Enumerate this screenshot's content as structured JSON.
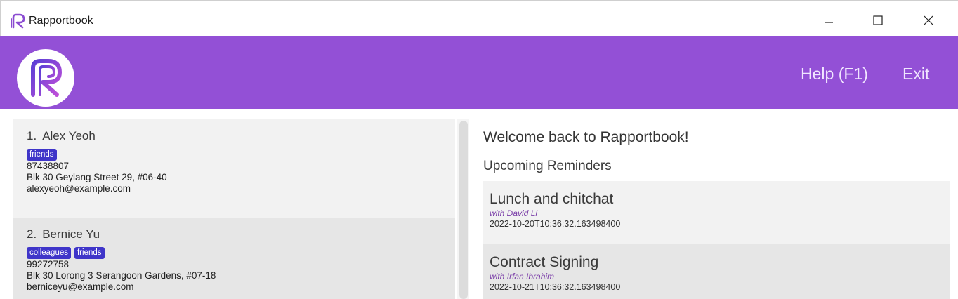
{
  "window": {
    "title": "Rapportbook",
    "controls": {
      "minimize_icon": "minimize-icon",
      "maximize_icon": "maximize-icon",
      "close_icon": "close-icon"
    }
  },
  "header": {
    "logo_icon": "rapportbook-logo",
    "menu": {
      "help": "Help (F1)",
      "exit": "Exit"
    },
    "brand_color": "#9350d6"
  },
  "persons": [
    {
      "index": "1.",
      "name": "Alex Yeoh",
      "tags": [
        "friends"
      ],
      "phone": "87438807",
      "address": "Blk 30 Geylang Street 29, #06-40",
      "email": "alexyeoh@example.com"
    },
    {
      "index": "2.",
      "name": "Bernice Yu",
      "tags": [
        "colleagues",
        "friends"
      ],
      "phone": "99272758",
      "address": "Blk 30 Lorong 3 Serangoon Gardens, #07-18",
      "email": "berniceyu@example.com"
    }
  ],
  "main": {
    "welcome": "Welcome back to Rapportbook!",
    "reminders_title": "Upcoming Reminders",
    "reminders": [
      {
        "title": "Lunch and chitchat",
        "with": "with David Li",
        "date": "2022-10-20T10:36:32.163498400"
      },
      {
        "title": "Contract Signing",
        "with": "with Irfan Ibrahim",
        "date": "2022-10-21T10:36:32.163498400"
      }
    ]
  },
  "colors": {
    "tag": "#3f35c9",
    "reminder_with": "#7a3da8"
  }
}
